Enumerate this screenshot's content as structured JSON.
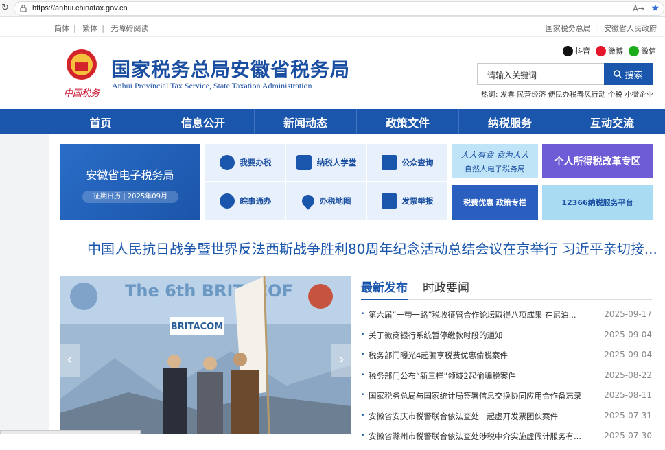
{
  "browser": {
    "url": "https://anhui.chinatax.gov.cn",
    "reader_label": "A→"
  },
  "topbar": {
    "left_links": [
      "简体",
      "繁体",
      "无障碍阅读"
    ],
    "right_links": [
      "国家税务总局",
      "安徽省人民政府"
    ]
  },
  "header": {
    "title": "国家税务总局安徽省税务局",
    "subtitle": "Anhui Provincial Tax Service, State Taxation Administration",
    "logo_caption": "中国税务",
    "social": [
      {
        "label": "抖音",
        "color": "#111111",
        "icon": "douyin-icon"
      },
      {
        "label": "微博",
        "color": "#e6162d",
        "icon": "weibo-icon"
      },
      {
        "label": "微信",
        "color": "#1aad19",
        "icon": "wechat-icon"
      }
    ],
    "search": {
      "placeholder": "请输入关键词",
      "button": "搜索"
    },
    "hot": {
      "label": "热词:",
      "terms": [
        "发票",
        "民营经济",
        "便民办税春风行动",
        "个税",
        "小微企业"
      ]
    }
  },
  "nav": [
    "首页",
    "信息公开",
    "新闻动态",
    "政策文件",
    "纳税服务",
    "互动交流"
  ],
  "etax": {
    "title": "安徽省电子税务局",
    "badge": "征期日历 | 2025年09月"
  },
  "tiles": [
    {
      "label": "我要办税",
      "icon": "tax-handling-icon"
    },
    {
      "label": "纳税人学堂",
      "icon": "classroom-icon"
    },
    {
      "label": "公众查询",
      "icon": "search-doc-icon"
    },
    {
      "label": "皖事通办",
      "icon": "compass-icon"
    },
    {
      "label": "办税地图",
      "icon": "map-pin-icon"
    },
    {
      "label": "发票举报",
      "icon": "invoice-report-icon"
    }
  ],
  "banners": [
    {
      "label": "自然人电子税务局",
      "color": "#bfe3f7",
      "text_color": "#1a4ea1",
      "headline": "人人有我 我为人人"
    },
    {
      "label": "个人所得税改革专区",
      "color": "#6e5bd6",
      "text_color": "#ffffff"
    },
    {
      "label": "税费优惠 政策专栏",
      "color": "#2a5fbf",
      "text_color": "#ffffff"
    },
    {
      "label": "12366纳税服务平台",
      "color": "#a9dcf2",
      "text_color": "#1a4ea1"
    }
  ],
  "headline": "中国人民抗日战争暨世界反法西斯战争胜利80周年纪念活动总结会议在京举行 习近平亲切接...",
  "photo": {
    "banner_text": "The 6th BRITACOF",
    "flag_text": "BRITACOM"
  },
  "news_tabs": {
    "active": "最新发布",
    "other": "时政要闻"
  },
  "news": [
    {
      "title": "第六届“一带一路”税收征管合作论坛取得八项成果 在尼泊...",
      "date": "2025-09-17"
    },
    {
      "title": "关于徽商银行系统暂停缴款时段的通知",
      "date": "2025-09-04"
    },
    {
      "title": "税务部门曝光4起骗享税费优惠偷税案件",
      "date": "2025-09-04"
    },
    {
      "title": "税务部门公布“新三样”领域2起偷骗税案件",
      "date": "2025-08-22"
    },
    {
      "title": "国家税务总局与国家统计局签署信息交换协同应用合作备忘录",
      "date": "2025-08-11"
    },
    {
      "title": "安徽省安庆市税警联合依法查处一起虚开发票团伙案件",
      "date": "2025-07-31"
    },
    {
      "title": "安徽省滁州市税警联合依法查处涉税中介实施虚假计服务有...",
      "date": "2025-07-30"
    }
  ]
}
